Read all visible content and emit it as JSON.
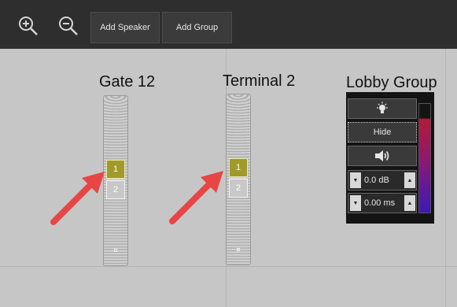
{
  "toolbar": {
    "zoom_in_icon": "zoom-in-icon",
    "zoom_out_icon": "zoom-out-icon",
    "add_speaker_label": "Add Speaker",
    "add_group_label": "Add Group"
  },
  "speakers": [
    {
      "title": "Gate 12",
      "numbers": [
        "1",
        "2"
      ],
      "active_number": "1"
    },
    {
      "title": "Terminal 2",
      "numbers": [
        "1",
        "2"
      ],
      "active_number": "1"
    }
  ],
  "group": {
    "title": "Lobby Group",
    "light_icon": "lightbulb-icon",
    "hide_label": "Hide",
    "speaker_icon": "speaker-volume-icon",
    "gain_value": "0.0 dB",
    "delay_value": "0.00 ms"
  },
  "colors": {
    "toolbar_bg": "#2e2e2e",
    "canvas_bg": "#c6c6c6",
    "active_number_bg": "#a09a2a",
    "annotation_arrow": "#e84545"
  }
}
